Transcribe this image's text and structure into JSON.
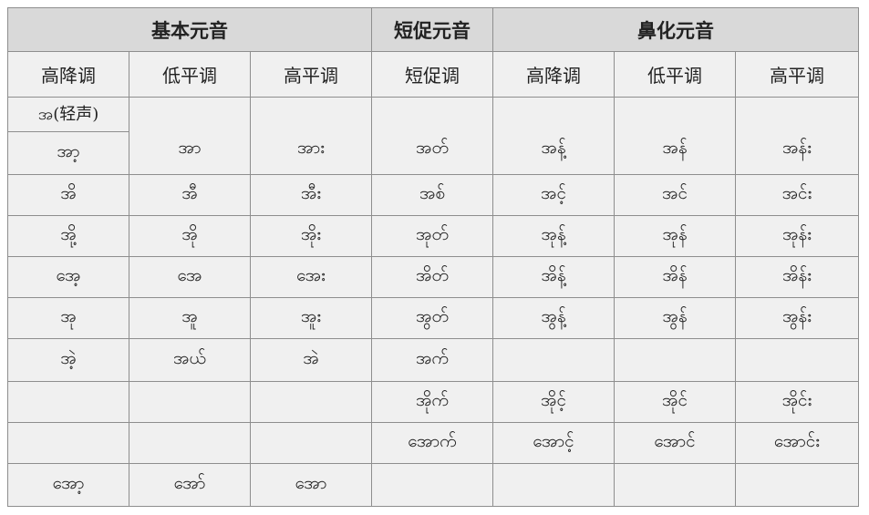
{
  "headers": {
    "group": [
      "基本元音",
      "短促元音",
      "鼻化元音"
    ],
    "sub": [
      "高降调",
      "低平调",
      "高平调",
      "短促调",
      "高降调",
      "低平调",
      "高平调"
    ]
  },
  "light_tone": "အ(轻声)",
  "rows": [
    [
      "အာ့",
      "အာ",
      "အား",
      "အတ်",
      "အန့်",
      "အန်",
      "အန်း"
    ],
    [
      "အိ",
      "အီ",
      "အီး",
      "အစ်",
      "အင့်",
      "အင်",
      "အင်း"
    ],
    [
      "အို့",
      "အို",
      "အိုး",
      "အုတ်",
      "အုန့်",
      "အုန်",
      "အုန်း"
    ],
    [
      "အေ့",
      "အေ",
      "အေး",
      "အိတ်",
      "အိန့်",
      "အိန်",
      "အိန်း"
    ],
    [
      "အု",
      "အူ",
      "အူး",
      "အွတ်",
      "အွန့်",
      "အွန်",
      "အွန်း"
    ],
    [
      "အဲ့",
      "အယ်",
      "အဲ",
      "အက်",
      "",
      "",
      ""
    ],
    [
      "",
      "",
      "",
      "အိုက်",
      "အိုင့်",
      "အိုင်",
      "အိုင်း"
    ],
    [
      "",
      "",
      "",
      "အောက်",
      "အောင့်",
      "အောင်",
      "အောင်း"
    ],
    [
      "အော့",
      "အော်",
      "အော",
      "",
      "",
      "",
      ""
    ]
  ],
  "colors": {
    "header_bg": "#d9d9d9",
    "body_bg": "#f0f0f0",
    "border": "#8e8e8e"
  }
}
